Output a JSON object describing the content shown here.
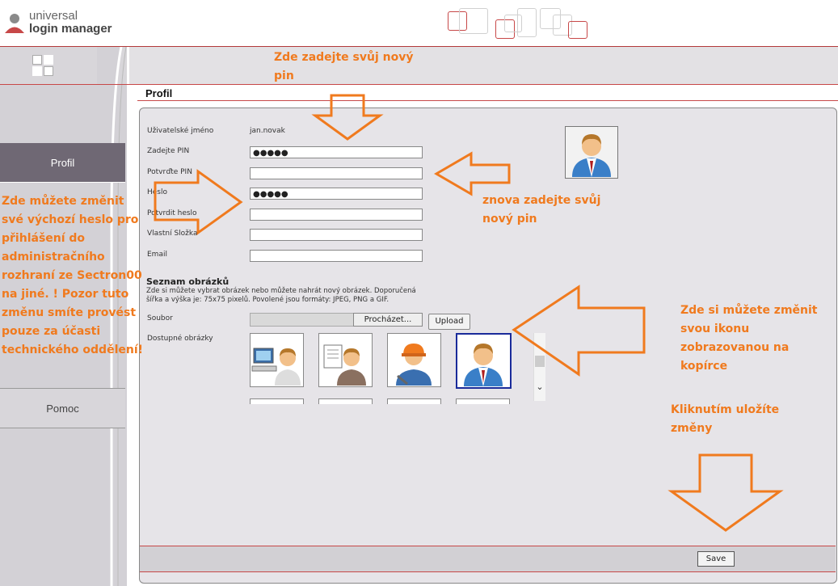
{
  "header": {
    "logo_line1": "universal",
    "logo_line2": "login manager",
    "brand_color": "#c74848"
  },
  "sidebar": {
    "items": [
      {
        "label": "Profil",
        "active": true
      },
      {
        "label": "Pomoc",
        "active": false
      }
    ]
  },
  "main": {
    "title": "Profil",
    "form": {
      "username_label": "Uživatelské jméno",
      "username_value": "jan.novak",
      "pin_label": "Zadejte PIN",
      "pin_value": "●●●●●",
      "pin_confirm_label": "Potvrďte PIN",
      "pin_confirm_value": "",
      "password_label": "Heslo",
      "password_value": "●●●●●",
      "password_confirm_label": "Potvrdit heslo",
      "password_confirm_value": "",
      "folder_label": "Vlastní Složka",
      "folder_value": "",
      "email_label": "Email",
      "email_value": ""
    },
    "images": {
      "section_title": "Seznam obrázků",
      "description": "Zde si můžete vybrat obrázek nebo můžete nahrát nový obrázek. Doporučená šířka a výška je: 75x75 pixelů. Povolené jsou formáty: JPEG, PNG a GIF.",
      "file_label": "Soubor",
      "browse_label": "Procházet...",
      "upload_label": "Upload",
      "available_label": "Dostupné obrázky",
      "icons": [
        "computer-user-icon",
        "document-user-icon",
        "worker-helmet-icon",
        "businessman-icon"
      ]
    },
    "save_label": "Save"
  },
  "annotations": {
    "pin_note": "Zde zadejte svůj nový pin",
    "pin_confirm_note": "znova zadejte svůj nový pin",
    "password_note": "Zde můžete změnit své výchozí heslo pro přihlášení do administračního rozhraní ze Sectron00 na jiné. ! Pozor tuto změnu smíte provést pouze za účasti technického oddělení!",
    "icon_note": "Zde si můžete změnit svou ikonu zobrazovanou na kopírce",
    "save_note": "Kliknutím uložíte změny",
    "color": "#f07a1e"
  }
}
